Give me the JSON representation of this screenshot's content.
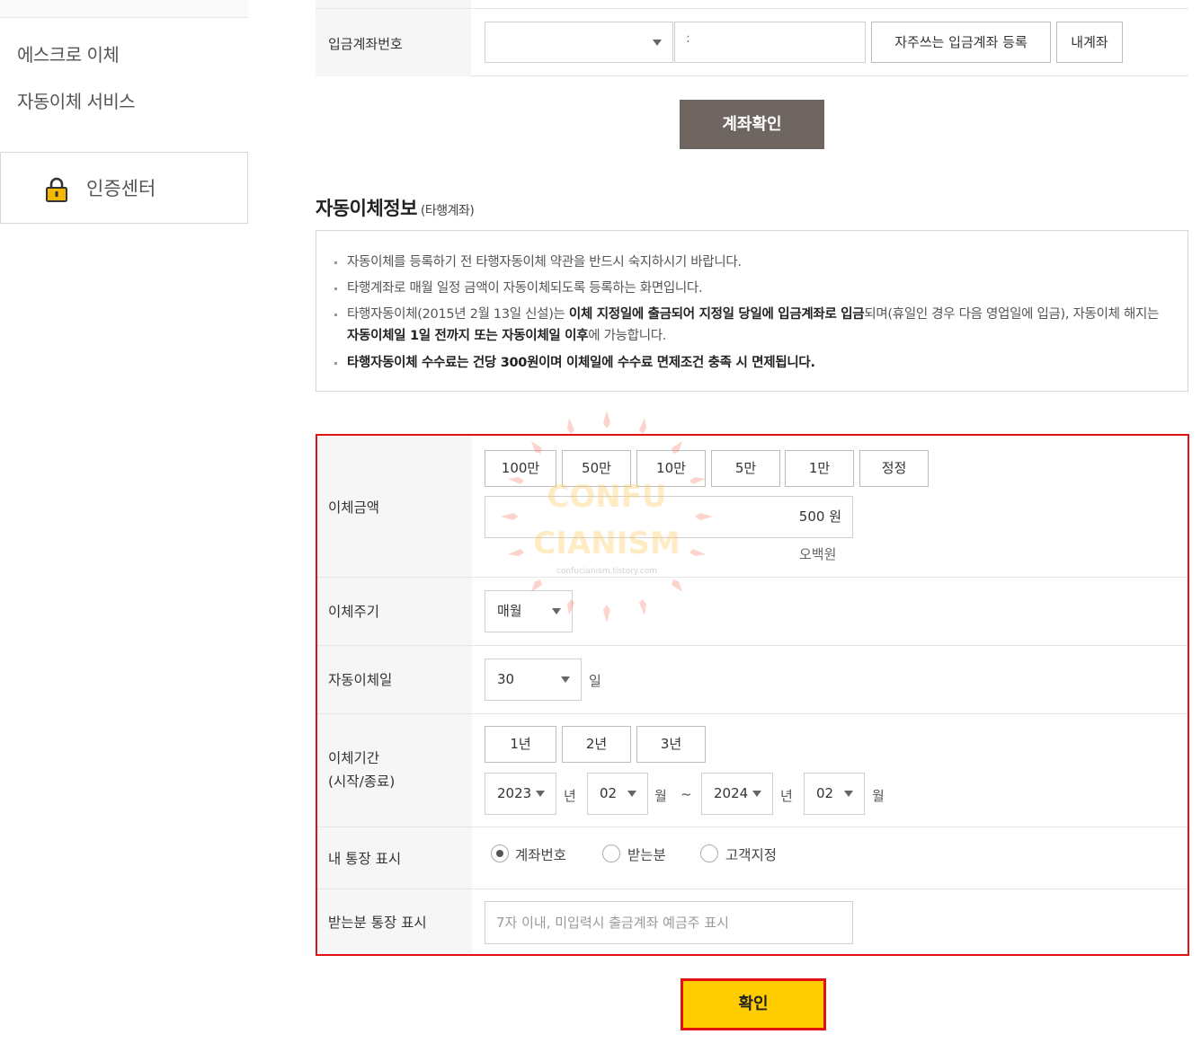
{
  "sidebar": {
    "items": [
      {
        "label": "에스크로 이체"
      },
      {
        "label": "자동이체 서비스"
      }
    ],
    "auth_center": {
      "label": "인증센터"
    }
  },
  "deposit_account": {
    "label": "입금계좌번호",
    "bank_select_value": "",
    "account_input_value": ":",
    "favorite_button": "자주쓰는 입금계좌 등록",
    "my_account_button": "내계좌"
  },
  "check_account_button": "계좌확인",
  "section": {
    "title": "자동이체정보",
    "subtitle": "(타행계좌)"
  },
  "notice": {
    "line1": "자동이체를 등록하기 전 타행자동이체 약관을 반드시 숙지하시기 바랍니다.",
    "line2": "타행계좌로 매월 일정 금액이 자동이체되도록 등록하는 화면입니다.",
    "line3": {
      "p1": "타행자동이체(2015년 2월 13일 신설)는 ",
      "b1": "이체 지정일에 출금되어 지정일 당일에 입금계좌로 입금",
      "p2": "되며(휴일인 경우 다음 영업일에 입금), 자동이체 해지는 ",
      "b2": "자동이체일 1일 전까지 또는 자동이체일 이후",
      "p3": "에 가능합니다."
    },
    "line4": "타행자동이체 수수료는 건당 300원이며 이체일에 수수료 면제조건 충족 시 면제됩니다."
  },
  "form": {
    "amount": {
      "label": "이체금액",
      "quick_buttons": [
        "100만",
        "50만",
        "10만",
        "5만",
        "1만",
        "정정"
      ],
      "value": "500 원",
      "hangul": "오백원"
    },
    "cycle": {
      "label": "이체주기",
      "value": "매월"
    },
    "day": {
      "label": "자동이체일",
      "value": "30",
      "unit": "일"
    },
    "period": {
      "label_line1": "이체기간",
      "label_line2": "(시작/종료)",
      "quick_buttons": [
        "1년",
        "2년",
        "3년"
      ],
      "start_year": "2023",
      "start_month": "02",
      "end_year": "2024",
      "end_month": "02",
      "year_unit": "년",
      "month_unit": "월",
      "separator": "~"
    },
    "my_passbook": {
      "label": "내 통장 표시",
      "options": [
        "계좌번호",
        "받는분",
        "고객지정"
      ],
      "selected": "계좌번호"
    },
    "recipient_passbook": {
      "label": "받는분 통장 표시",
      "placeholder": "7자 이내, 미입력시 출금계좌 예금주 표시"
    }
  },
  "confirm_button": "확인",
  "watermark": {
    "line1": "CONFU",
    "line2": "CIANISM",
    "line3": "confucianism.tistory.com"
  },
  "colors": {
    "check_button_bg": "#6e6560",
    "confirm_button_bg": "#ffcc00",
    "highlight_border": "#e31212",
    "lock_icon": "#f5b800"
  }
}
